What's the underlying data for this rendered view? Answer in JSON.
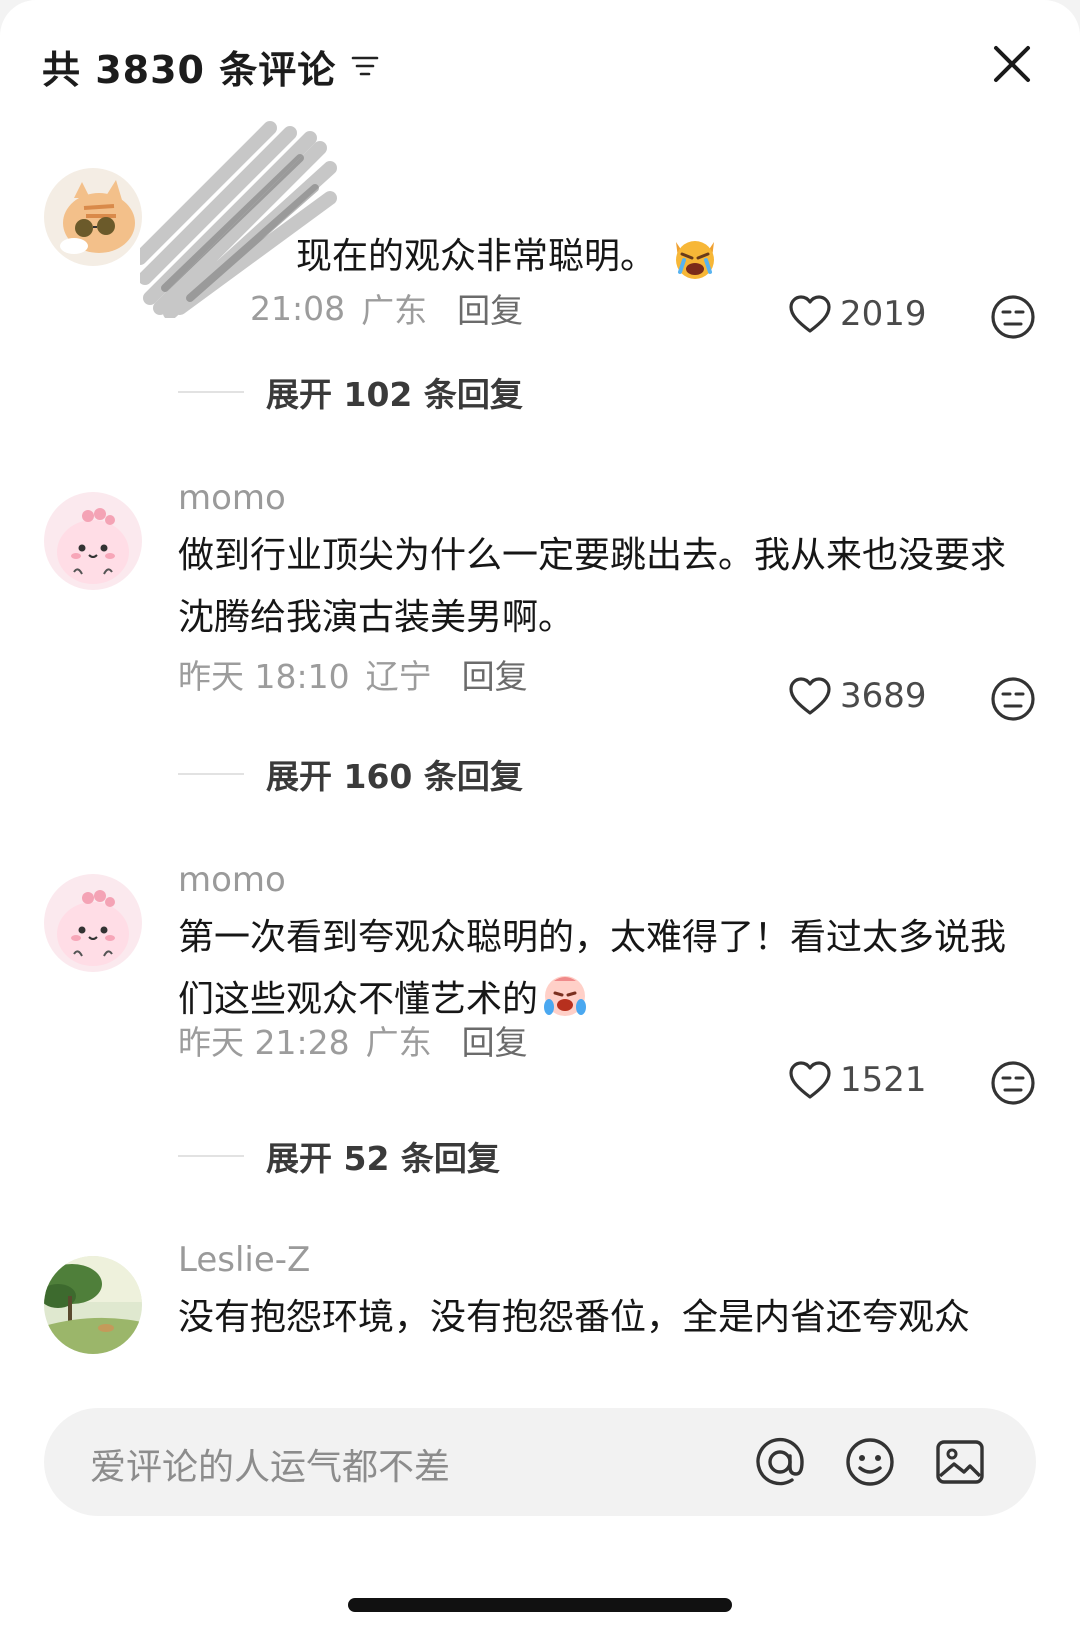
{
  "header": {
    "title": "共 3830 条评论"
  },
  "comments": [
    {
      "username": "",
      "text": "现在的观众非常聪明。",
      "time": "21:08",
      "location": "广东",
      "reply_label": "回复",
      "likes": "2019",
      "expand_label": "展开 102 条回复",
      "avatar_icon": "cat-avatar-icon"
    },
    {
      "username": "momo",
      "text": "做到行业顶尖为什么一定要跳出去。我从来也没要求沈腾给我演古装美男啊。",
      "time": "昨天 18:10",
      "location": "辽宁",
      "reply_label": "回复",
      "likes": "3689",
      "expand_label": "展开 160 条回复",
      "avatar_icon": "pink-blob-avatar-icon"
    },
    {
      "username": "momo",
      "text": "第一次看到夸观众聪明的，太难得了！看过太多说我们这些观众不懂艺术的",
      "time": "昨天 21:28",
      "location": "广东",
      "reply_label": "回复",
      "likes": "1521",
      "expand_label": "展开 52 条回复",
      "avatar_icon": "pink-blob-avatar-icon"
    },
    {
      "username": "Leslie-Z",
      "text": "没有抱怨环境，没有抱怨番位，全是内省还夸观众",
      "avatar_icon": "landscape-avatar-icon"
    }
  ],
  "input_bar": {
    "placeholder": "爱评论的人运气都不差"
  },
  "colors": {
    "background": "#ffffff",
    "secondary_text": "#9a9a9a",
    "input_bg": "#f2f2f2"
  }
}
